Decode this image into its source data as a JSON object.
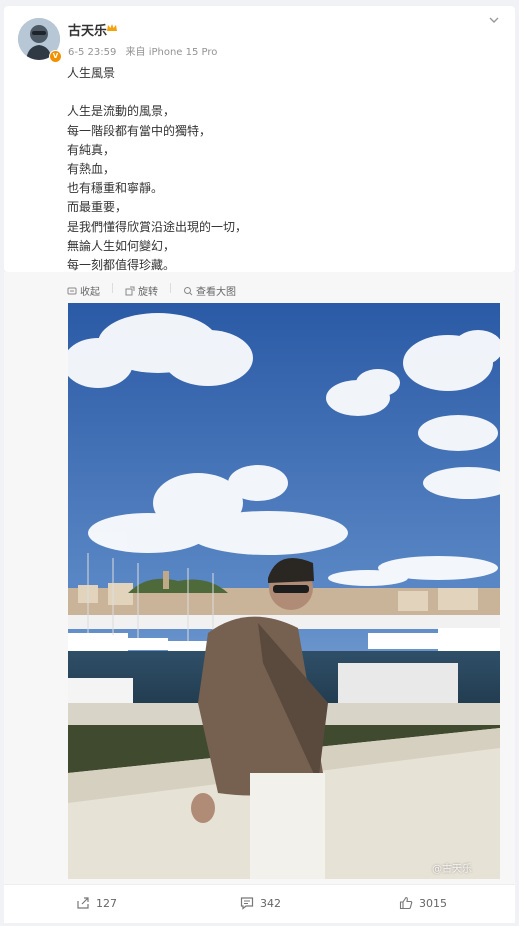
{
  "author": {
    "name": "古天乐",
    "verified_badge": "V"
  },
  "meta": {
    "time": "6-5 23:59",
    "source": "来自 iPhone 15 Pro"
  },
  "post": {
    "lines": [
      "人生風景",
      "",
      "人生是流動的風景，",
      "每一階段都有當中的獨特，",
      "有純真，",
      "有熱血，",
      "也有穩重和寧靜。",
      "而最重要，",
      "是我們懂得欣賞沿途出現的一切，",
      "無論人生如何變幻，",
      "每一刻都值得珍藏。"
    ]
  },
  "image_actions": {
    "collect": "收起",
    "rotate": "旋转",
    "view_large": "查看大图"
  },
  "photo": {
    "watermark": "@古天乐"
  },
  "footer": {
    "repost_count": "127",
    "comment_count": "342",
    "like_count": "3015"
  },
  "colors": {
    "accent": "#f29100",
    "sky_top": "#2f5fa8",
    "sky_bottom": "#a9c3e2"
  }
}
